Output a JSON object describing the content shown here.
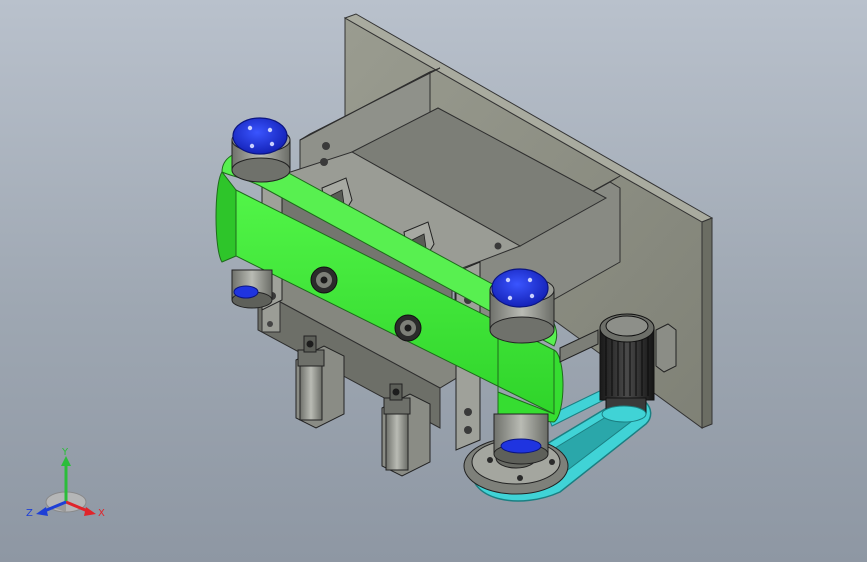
{
  "triad": {
    "x_label": "X",
    "y_label": "Y",
    "z_label": "Z",
    "x_color": "#e0242a",
    "y_color": "#2bbd3a",
    "z_color": "#1e3fd6"
  },
  "colors": {
    "belt_green": "#3ef036",
    "timing_belt": "#40d3d6",
    "pulley_blue": "#1f34e0",
    "steel": "#8c8f87",
    "back_plate": "#8d8f83"
  },
  "icons": [
    "coordinate-triad-icon"
  ]
}
